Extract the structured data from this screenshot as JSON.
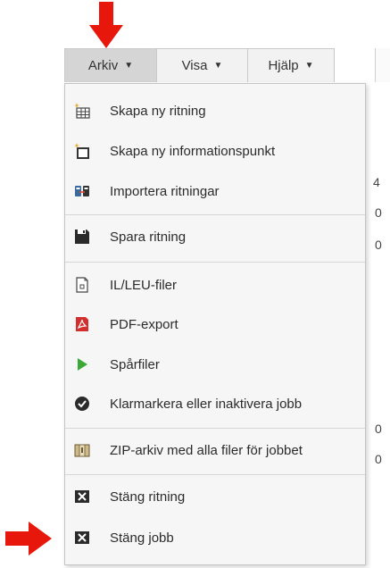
{
  "menubar": {
    "tabs": [
      {
        "label": "Arkiv"
      },
      {
        "label": "Visa"
      },
      {
        "label": "Hjälp"
      }
    ]
  },
  "arkiv_menu": {
    "items": [
      {
        "label": "Skapa ny ritning",
        "icon": "new-drawing-icon"
      },
      {
        "label": "Skapa ny informationspunkt",
        "icon": "new-infopoint-icon"
      },
      {
        "label": "Importera ritningar",
        "icon": "import-icon"
      },
      {
        "label": "Spara ritning",
        "icon": "save-icon"
      },
      {
        "label": "IL/LEU-filer",
        "icon": "file-icon"
      },
      {
        "label": "PDF-export",
        "icon": "pdf-icon"
      },
      {
        "label": "Spårfiler",
        "icon": "play-icon"
      },
      {
        "label": "Klarmarkera eller inaktivera jobb",
        "icon": "check-circle-icon"
      },
      {
        "label": "ZIP-arkiv med alla filer för jobbet",
        "icon": "zip-icon"
      },
      {
        "label": "Stäng ritning",
        "icon": "close-box-icon"
      },
      {
        "label": "Stäng jobb",
        "icon": "close-box-icon"
      }
    ]
  },
  "background_glyphs": [
    "4",
    "0",
    "0",
    "0",
    "0"
  ],
  "colors": {
    "arrow": "#e8170b",
    "pdf": "#d32f2f",
    "play": "#3aa935"
  }
}
